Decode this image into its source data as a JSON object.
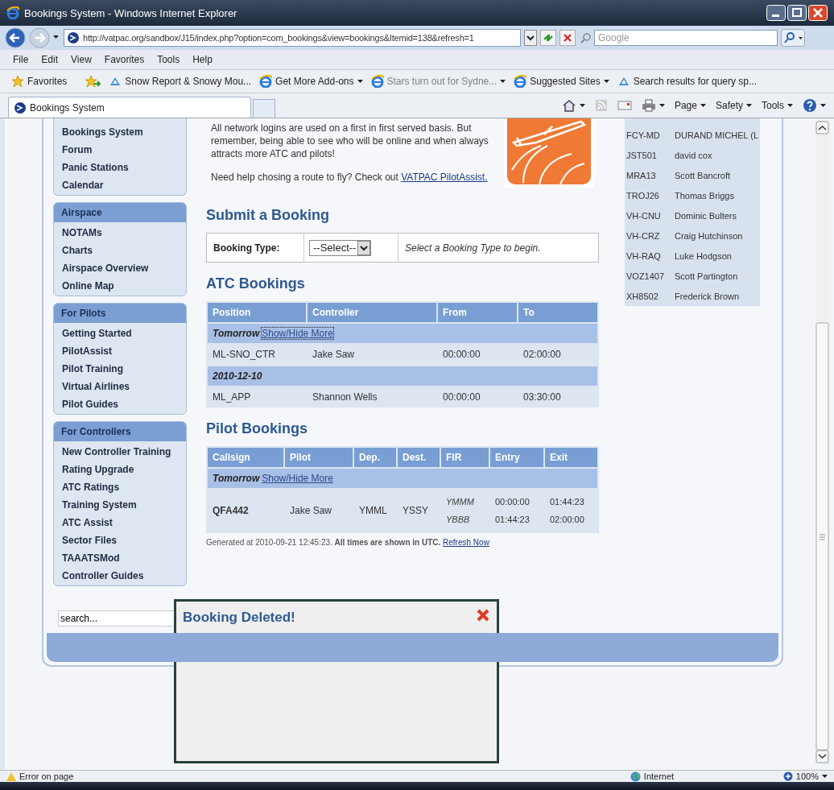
{
  "window": {
    "title": "Bookings System - Windows Internet Explorer"
  },
  "address_bar": {
    "url": "http://vatpac.org/sandbox/J15/index.php?option=com_bookings&view=bookings&Itemid=138&refresh=1"
  },
  "search": {
    "placeholder": "Google"
  },
  "menu": [
    "File",
    "Edit",
    "View",
    "Favorites",
    "Tools",
    "Help"
  ],
  "favorites_bar": {
    "label": "Favorites",
    "items": [
      {
        "label": "Snow Report & Snowy Mou...",
        "kind": "feed",
        "dropdown": false,
        "disabled": false
      },
      {
        "label": "Get More Add-ons",
        "kind": "page",
        "dropdown": true,
        "disabled": false
      },
      {
        "label": "Stars turn out for Sydne...",
        "kind": "page",
        "dropdown": true,
        "disabled": true
      },
      {
        "label": "Suggested Sites",
        "kind": "page",
        "dropdown": true,
        "disabled": false
      },
      {
        "label": "Search results for query  sp...",
        "kind": "feed",
        "dropdown": false,
        "disabled": false
      }
    ]
  },
  "tabs": [
    {
      "label": "Bookings System",
      "selected": true
    }
  ],
  "command_bar": [
    "Page",
    "Safety",
    "Tools"
  ],
  "sidebar": [
    {
      "items": [
        "Bookings System",
        "Forum",
        "Panic Stations",
        "Calendar"
      ]
    },
    {
      "heading": "Airspace",
      "items": [
        "NOTAMs",
        "Charts",
        "Airspace Overview",
        "Online Map"
      ]
    },
    {
      "heading": "For Pilots",
      "items": [
        "Getting Started",
        "PilotAssist",
        "Pilot Training",
        "Virtual Airlines",
        "Pilot Guides"
      ]
    },
    {
      "heading": "For Controllers",
      "items": [
        "New Controller Training",
        "Rating Upgrade",
        "ATC Ratings",
        "Training System",
        "ATC Assist",
        "Sector Files",
        "TAAATSMod",
        "Controller Guides"
      ]
    }
  ],
  "site_search": {
    "value": "search..."
  },
  "intro": {
    "text": "All network logins are used on a first in first served basis. But remember, being able to see who will be online and when always attracts more ATC and pilots!",
    "help": "Need help chosing a route to fly? Check out ",
    "link": "VATPAC PilotAssist."
  },
  "submit_booking": {
    "title": "Submit a Booking",
    "label": "Booking Type:",
    "select": "--Select--",
    "hint": "Select a Booking Type to begin."
  },
  "atc_bookings": {
    "title": "ATC Bookings",
    "columns": [
      "Position",
      "Controller",
      "From",
      "To"
    ],
    "groups": [
      {
        "label": "Tomorrow",
        "link": "Show/Hide More",
        "focused": true,
        "rows": [
          [
            "ML-SNO_CTR",
            "Jake Saw",
            "00:00:00",
            "02:00:00"
          ]
        ]
      },
      {
        "label": "2010-12-10",
        "rows": [
          [
            "ML_APP",
            "Shannon Wells",
            "00:00:00",
            "03:30:00"
          ]
        ]
      }
    ]
  },
  "pilot_bookings": {
    "title": "Pilot Bookings",
    "columns": [
      "Callsign",
      "Pilot",
      "Dep.",
      "Dest.",
      "FIR",
      "Entry",
      "Exit"
    ],
    "groups": [
      {
        "label": "Tomorrow",
        "link": "Show/Hide More",
        "focused": false,
        "rows": [
          {
            "callsign": "QFA442",
            "pilot": "Jake Saw",
            "dep": "YMML",
            "dest": "YSSY",
            "segments": [
              [
                "YMMM",
                "00:00:00",
                "01:44:23"
              ],
              [
                "YBBB",
                "01:44:23",
                "02:00:00"
              ]
            ]
          }
        ]
      }
    ]
  },
  "footer_note": {
    "text": "Generated at 2010-09-21 12:45:23. **All times are shown in UTC.** ",
    "link": "Refresh Now"
  },
  "online_list": [
    [
      "FCY-MD",
      "DURAND MICHEL (L"
    ],
    [
      "JST501",
      "david cox"
    ],
    [
      "MRA13",
      "Scott Bancroft"
    ],
    [
      "TROJ26",
      "Thomas Briggs"
    ],
    [
      "VH-CNU",
      "Dominic Bulters"
    ],
    [
      "VH-CRZ",
      "Craig Hutchinson"
    ],
    [
      "VH-RAQ",
      "Luke Hodgson"
    ],
    [
      "VOZ1407",
      "Scott Partington"
    ],
    [
      "XH8502",
      "Frederick Brown"
    ]
  ],
  "dialog": {
    "title": "Booking Deleted!"
  },
  "status_bar": {
    "message": "Error on page",
    "zone": "Internet",
    "zoom": "100%"
  }
}
